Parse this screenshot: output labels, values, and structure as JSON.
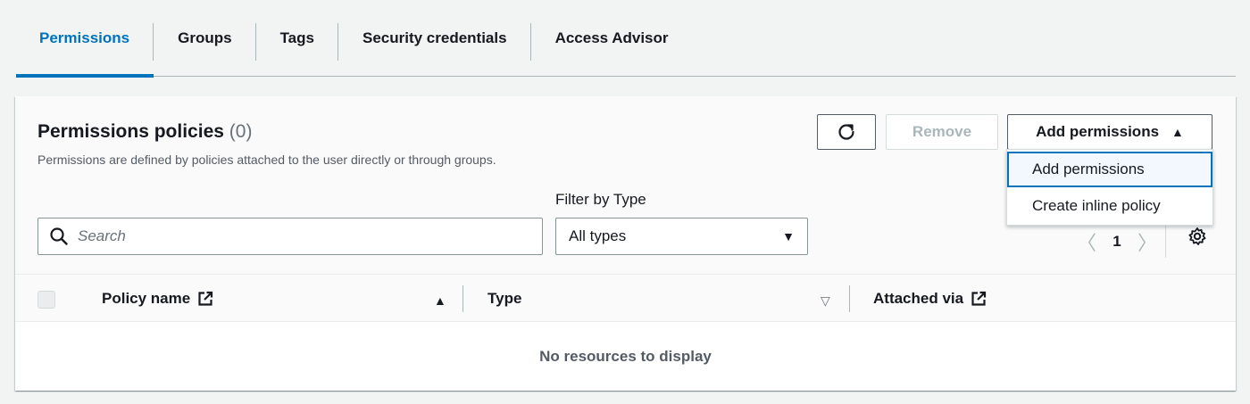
{
  "tabs": [
    {
      "label": "Permissions",
      "active": true
    },
    {
      "label": "Groups"
    },
    {
      "label": "Tags"
    },
    {
      "label": "Security credentials"
    },
    {
      "label": "Access Advisor"
    }
  ],
  "panel": {
    "title": "Permissions policies",
    "count": "(0)",
    "description": "Permissions are defined by policies attached to the user directly or through groups."
  },
  "actions": {
    "refresh_icon": "refresh-icon",
    "remove_label": "Remove",
    "add_label": "Add permissions",
    "add_caret": "▲"
  },
  "menu": {
    "items": [
      "Add permissions",
      "Create inline policy"
    ]
  },
  "filters": {
    "search_placeholder": "Search",
    "type_label": "Filter by Type",
    "type_value": "All types",
    "type_arrow": "▼"
  },
  "pagination": {
    "prev": "〈",
    "page": "1",
    "next": "〉"
  },
  "table": {
    "columns": [
      "Policy name",
      "Type",
      "Attached via"
    ],
    "sort_asc": "▲",
    "sort_desc": "▽",
    "empty": "No resources to display"
  },
  "colors": {
    "accent": "#0073bb",
    "border": "#879596"
  }
}
